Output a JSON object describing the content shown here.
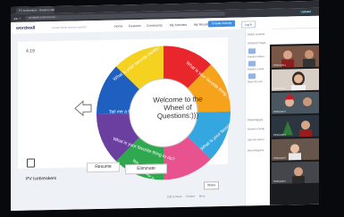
{
  "browser": {
    "tab_title": "PV Icebreakers - Random wheel",
    "url": "wordwall.net/resource/...",
    "profile_label": "Updated"
  },
  "header": {
    "logo": "wordwall",
    "tagline": "Create better lessons quicker",
    "nav": [
      "Home",
      "Features",
      "Community",
      "My Activities",
      "My Results"
    ],
    "create_button": "Create Activity",
    "login_button": "Log in"
  },
  "activity": {
    "timer": "4:19",
    "center_text": "Welcome to the Wheel of Questions:)))",
    "segment_texts": [
      "What is your favorite candy?",
      "Tell me a funny joke!",
      "What is your favorite thing to do?",
      "What is your favorite Christmas movie?",
      "What is your favorite thing...",
      "What is your favorite..."
    ],
    "resume_button": "Resume",
    "eliminate_button": "Eliminate",
    "title": "PV Icebreakers",
    "share_button": "Share",
    "bottom_links": [
      "Edit Content",
      "Embed",
      "More"
    ]
  },
  "side_panel": {
    "switch_template": "Switch template",
    "interactives": "INTERACTIVES",
    "printables": "PRINTABLES",
    "items": [
      "Random wheel",
      "Random cards",
      "Open the box",
      "Random Cards",
      "Spin the wheel",
      "Word Magnets"
    ]
  },
  "zoom": {
    "participants": [
      "Participant 1",
      "Participant 2",
      "Participant 3",
      "Participant 4",
      "Participant 5",
      "Participant 6"
    ]
  },
  "colors": {
    "accent": "#3b8ee8",
    "wheel": [
      "#e8262b",
      "#f6a21b",
      "#35a7e0",
      "#6b3fa0",
      "#e8528f",
      "#2fa84f",
      "#f4d21f",
      "#1f5fbf"
    ]
  }
}
